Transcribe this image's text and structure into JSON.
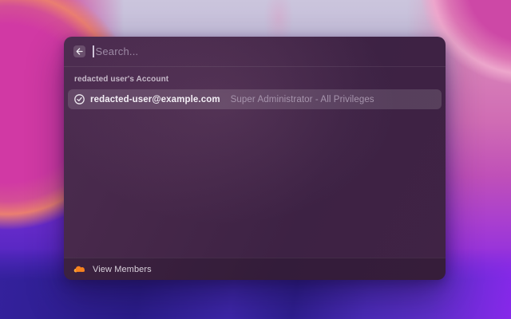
{
  "search": {
    "placeholder": "Search..."
  },
  "section": {
    "title": "redacted user's Account"
  },
  "results": [
    {
      "email": "redacted-user@example.com",
      "role": "Super Administrator - All Privileges",
      "status_icon": "check-circle"
    }
  ],
  "footer": {
    "view_members": "View Members",
    "logo_icon": "cloudflare-cloud"
  },
  "icons": {
    "back": "arrow-left",
    "result_selected": "check-circle",
    "brand": "cloudflare-cloud"
  },
  "colors": {
    "brand_orange": "#f6821f",
    "brand_orange_light": "#fbad41",
    "window_purple": "#42254a",
    "row_highlight": "rgba(255,255,255,0.135)",
    "wallpaper_magenta": "#d139a4",
    "wallpaper_coral": "#ea7e71",
    "wallpaper_violet": "#7334c8",
    "wallpaper_indigo": "#2b1d8c",
    "wallpaper_lavender": "#cbc5dd"
  }
}
